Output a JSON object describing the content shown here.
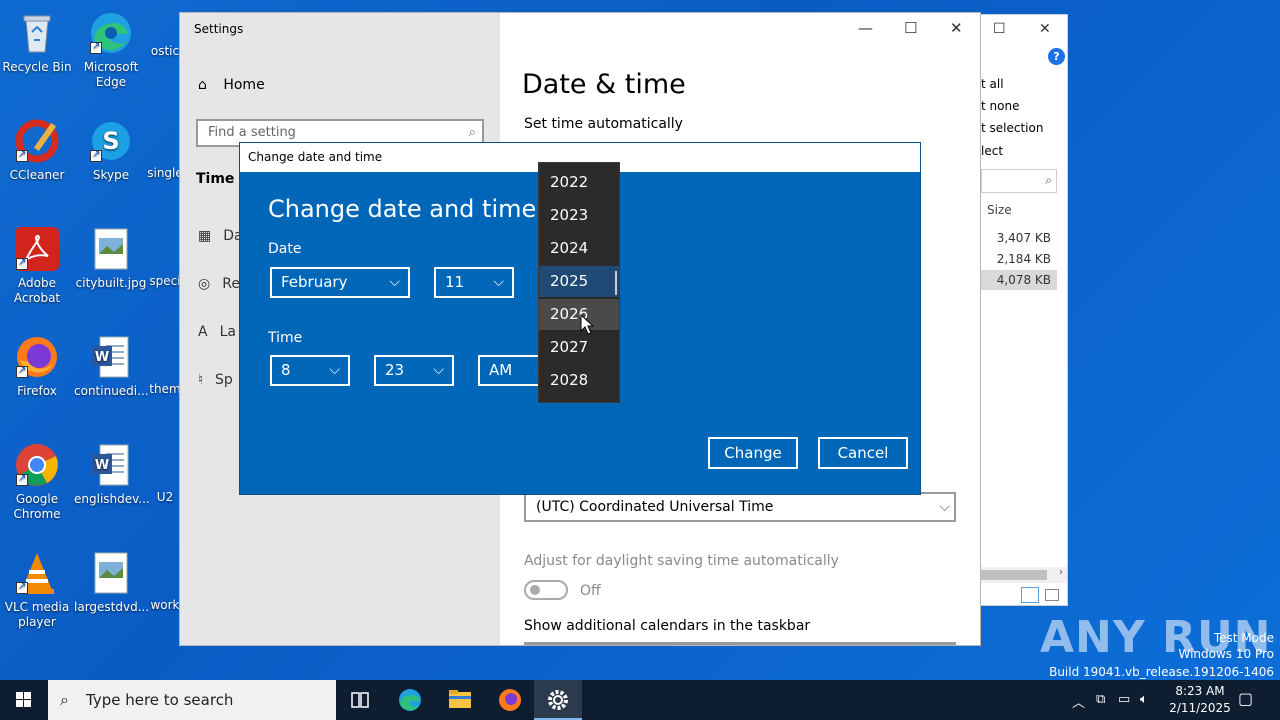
{
  "desktop": {
    "icons": [
      {
        "label": "Recycle Bin"
      },
      {
        "label": "Microsoft Edge"
      },
      {
        "label": "ostic"
      },
      {
        "label": "CCleaner"
      },
      {
        "label": "Skype"
      },
      {
        "label": "single"
      },
      {
        "label": "Adobe Acrobat"
      },
      {
        "label": "citybuilt.jpg"
      },
      {
        "label": "speci"
      },
      {
        "label": "Firefox"
      },
      {
        "label": "continuedi..."
      },
      {
        "label": "them"
      },
      {
        "label": "Google Chrome"
      },
      {
        "label": "englishdev..."
      },
      {
        "label": "U2"
      },
      {
        "label": "VLC media player"
      },
      {
        "label": "largestdvd..."
      },
      {
        "label": "work"
      }
    ]
  },
  "explorer": {
    "menu": [
      "t all",
      "t none",
      "t selection",
      "lect"
    ],
    "size_header": "Size",
    "sizes": [
      "3,407 KB",
      "2,184 KB",
      "4,078 KB"
    ]
  },
  "settings": {
    "title": "Settings",
    "home": "Home",
    "search_placeholder": "Find a setting",
    "section_title": "Time &",
    "nav": [
      "Da",
      "Re",
      "La",
      "Sp"
    ],
    "page_title": "Date & time",
    "set_time_automatically": "Set time automatically",
    "timezone": "(UTC) Coordinated Universal Time",
    "dst_label": "Adjust for daylight saving time automatically",
    "dst_state": "Off",
    "additional_calendars": "Show additional calendars in the taskbar"
  },
  "dialog": {
    "window_title": "Change date and time",
    "heading": "Change date and time",
    "date_label": "Date",
    "month": "February",
    "day": "11",
    "time_label": "Time",
    "hour": "8",
    "minute": "23",
    "ampm": "AM",
    "change_button": "Change",
    "cancel_button": "Cancel"
  },
  "year_list": {
    "items": [
      "2022",
      "2023",
      "2024",
      "2025",
      "2026",
      "2027",
      "2028"
    ],
    "selected": "2025",
    "hovered": "2026"
  },
  "watermark": {
    "brand": "ANY RUN",
    "mode": "Test Mode",
    "os": "Windows 10 Pro",
    "build": "Build 19041.vb_release.191206-1406"
  },
  "taskbar": {
    "search_placeholder": "Type here to search",
    "time": "8:23 AM",
    "date": "2/11/2025"
  },
  "colors": {
    "dialog_bg": "#0067b8",
    "year_selected": "#1f4a75",
    "taskbar": "#0e1d2f"
  }
}
